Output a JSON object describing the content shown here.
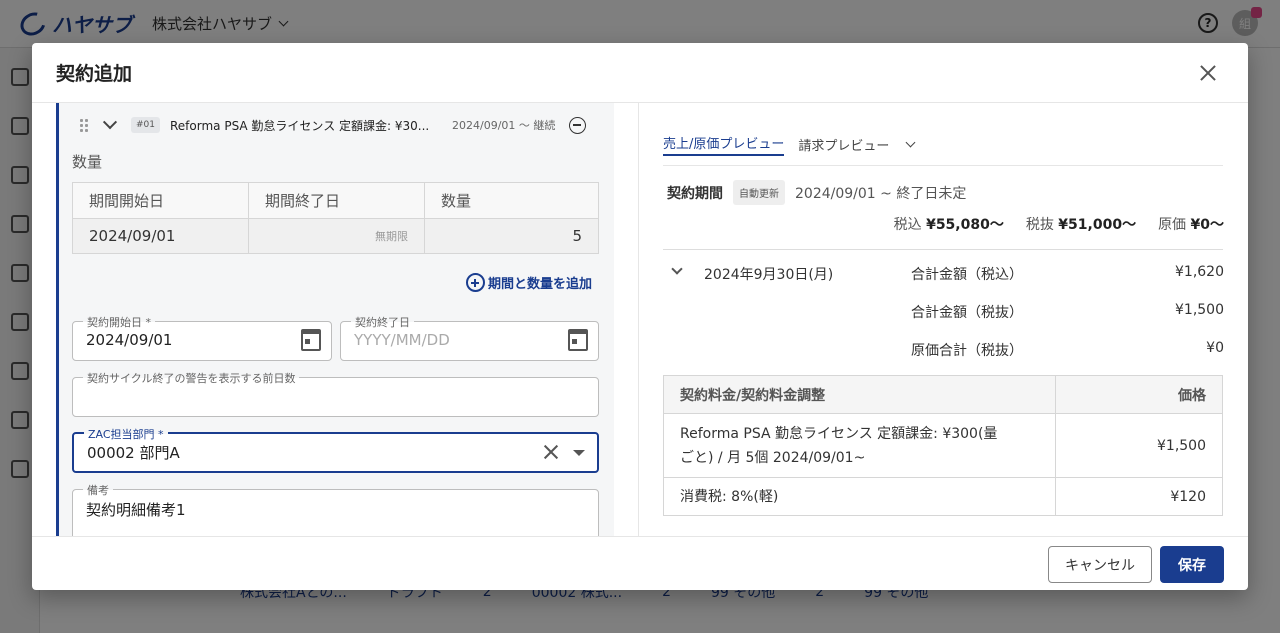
{
  "app": {
    "logo_text": "ハヤサブ",
    "company": "株式会社ハヤサブ",
    "avatar_initial": "組",
    "background_row": [
      "株式会社Aとの...",
      "ドラフト",
      "2",
      "00002 株式...",
      "2",
      "99 その他",
      "2",
      "99 その他"
    ]
  },
  "modal": {
    "title": "契約追加",
    "item": {
      "number": "#01",
      "name": "Reforma PSA 勤怠ライセンス 定額課金: ¥30...",
      "period": "2024/09/01 〜 継続"
    },
    "quantity": {
      "label": "数量",
      "headers": [
        "期間開始日",
        "期間終了日",
        "数量"
      ],
      "rows": [
        {
          "start": "2024/09/01",
          "end": "無期限",
          "qty": "5"
        }
      ],
      "add_label": "期間と数量を追加"
    },
    "fields": {
      "contract_start": {
        "label": "契約開始日 *",
        "value": "2024/09/01"
      },
      "contract_end": {
        "label": "契約終了日",
        "placeholder": "YYYY/MM/DD"
      },
      "warning_days": {
        "label": "契約サイクル終了の警告を表示する前日数",
        "value": ""
      },
      "zac_dept": {
        "label": "ZAC担当部門 *",
        "value": "00002 部門A"
      },
      "notes": {
        "label": "備考",
        "value": "契約明細備考1"
      }
    },
    "preview": {
      "tabs": [
        "売上/原価プレビュー",
        "請求プレビュー"
      ],
      "period_title": "契約期間",
      "auto_renew_badge": "自動更新",
      "period_range": "2024/09/01 ~ 終了日未定",
      "totals": [
        {
          "label": "税込",
          "value": "¥55,080〜"
        },
        {
          "label": "税抜",
          "value": "¥51,000〜"
        },
        {
          "label": "原価",
          "value": "¥0〜"
        }
      ],
      "month": "2024年9月30日(月)",
      "sums": [
        {
          "label": "合計金額（税込）",
          "value": "¥1,620"
        },
        {
          "label": "合計金額（税抜）",
          "value": "¥1,500"
        },
        {
          "label": "原価合計（税抜）",
          "value": "¥0"
        }
      ],
      "fee_table": {
        "headers": [
          "契約料金/契約料金調整",
          "価格"
        ],
        "rows": [
          {
            "desc_line1": "Reforma PSA 勤怠ライセンス 定額課金: ¥300(量",
            "desc_line2": "ごと) / 月 5個 2024/09/01~",
            "price": "¥1,500"
          },
          {
            "desc_line1": "消費税: 8%(軽)",
            "desc_line2": "",
            "price": "¥120"
          }
        ]
      }
    },
    "footer": {
      "cancel_label": "キャンセル",
      "save_label": "保存"
    }
  },
  "colors": {
    "accent": "#1a3d8f",
    "badge": "#e8488a"
  }
}
